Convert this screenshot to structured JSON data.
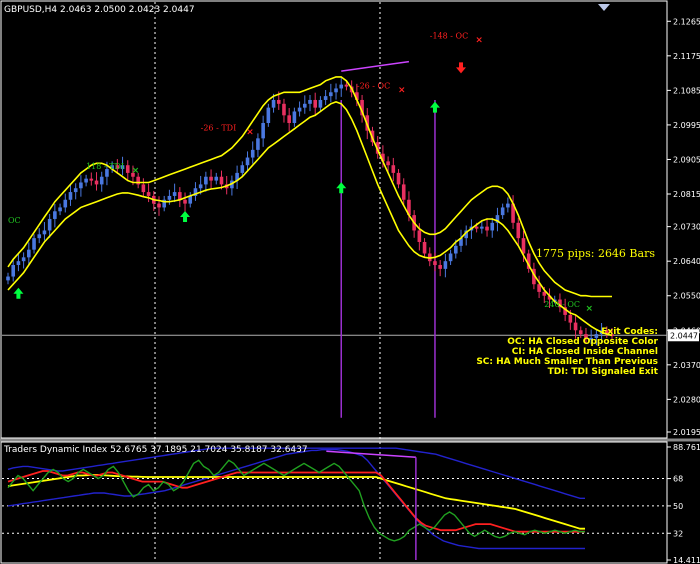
{
  "header": {
    "symbol": "GBPUSD,H4",
    "ohlc": "2.0463 2.0500 2.0423 2.0447"
  },
  "chart_data": [
    {
      "type": "candlestick",
      "name": "main",
      "ylim": [
        2.0195,
        2.131
      ],
      "y_ticks": [
        {
          "value": 2.1265,
          "label": "2.1265"
        },
        {
          "value": 2.1175,
          "label": "2.1175"
        },
        {
          "value": 2.1085,
          "label": "2.1085"
        },
        {
          "value": 2.0995,
          "label": "2.0995"
        },
        {
          "value": 2.0905,
          "label": "2.0905"
        },
        {
          "value": 2.0815,
          "label": "2.0815"
        },
        {
          "value": 2.073,
          "label": "2.0730"
        },
        {
          "value": 2.064,
          "label": "2.0640"
        },
        {
          "value": 2.055,
          "label": "2.0550"
        },
        {
          "value": 2.046,
          "label": "2.0460"
        },
        {
          "value": 2.037,
          "label": "2.0370"
        },
        {
          "value": 2.028,
          "label": "2.0280"
        },
        {
          "value": 2.0195,
          "label": "2.0195"
        }
      ],
      "current_price": {
        "value": 2.0447,
        "label": "2.0447"
      },
      "close_series": [
        2.06,
        2.063,
        2.064,
        2.065,
        2.067,
        2.07,
        2.071,
        2.072,
        2.075,
        2.077,
        2.078,
        2.08,
        2.082,
        2.083,
        2.0845,
        2.0855,
        2.085,
        2.084,
        2.086,
        2.088,
        2.089,
        2.088,
        2.089,
        2.087,
        2.086,
        2.084,
        2.082,
        2.081,
        2.079,
        2.078,
        2.08,
        2.081,
        2.082,
        2.08,
        2.079,
        2.081,
        2.083,
        2.084,
        2.086,
        2.085,
        2.086,
        2.084,
        2.083,
        2.085,
        2.087,
        2.089,
        2.091,
        2.093,
        2.096,
        2.1,
        2.104,
        2.106,
        2.105,
        2.102,
        2.1,
        2.103,
        2.104,
        2.105,
        2.106,
        2.104,
        2.106,
        2.107,
        2.108,
        2.109,
        2.11,
        2.1095,
        2.108,
        2.106,
        2.102,
        2.098,
        2.095,
        2.092,
        2.09,
        2.089,
        2.087,
        2.084,
        2.08,
        2.076,
        2.072,
        2.069,
        2.066,
        2.064,
        2.063,
        2.062,
        2.064,
        2.066,
        2.068,
        2.07,
        2.072,
        2.073,
        2.0725,
        2.073,
        2.072,
        2.074,
        2.076,
        2.078,
        2.079,
        2.074,
        2.07,
        2.066,
        2.062,
        2.058,
        2.056,
        2.055,
        2.054,
        2.054,
        2.052,
        2.05,
        2.048,
        2.046,
        2.045,
        2.044,
        2.044,
        2.045,
        2.046,
        2.045,
        2.0447
      ],
      "upper_band": [
        2.0625,
        2.0645,
        2.066,
        2.0675,
        2.0695,
        2.0715,
        2.0735,
        2.0755,
        2.0775,
        2.0795,
        2.081,
        2.0825,
        2.084,
        2.0855,
        2.087,
        2.088,
        2.089,
        2.0895,
        2.0895,
        2.089,
        2.088,
        2.087,
        2.086,
        2.085,
        2.0845,
        2.0845,
        2.0845,
        2.0845,
        2.085,
        2.0855,
        2.086,
        2.0865,
        2.087,
        2.0875,
        2.088,
        2.0885,
        2.089,
        2.0895,
        2.09,
        2.0905,
        2.091,
        2.0915,
        2.0925,
        2.0935,
        2.095,
        2.0965,
        2.0985,
        2.1005,
        2.1025,
        2.1045,
        2.106,
        2.107,
        2.1075,
        2.108,
        2.108,
        2.108,
        2.108,
        2.1085,
        2.109,
        2.1095,
        2.11,
        2.111,
        2.1115,
        2.112,
        2.112,
        2.111,
        2.109,
        2.106,
        2.103,
        2.0995,
        2.096,
        2.093,
        2.09,
        2.087,
        2.084,
        2.081,
        2.0785,
        2.076,
        2.074,
        2.0725,
        2.0715,
        2.071,
        2.071,
        2.0715,
        2.0725,
        2.074,
        2.0755,
        2.077,
        2.0785,
        2.08,
        2.081,
        2.082,
        2.083,
        2.0835,
        2.0835,
        2.083,
        2.0815,
        2.079,
        2.076,
        2.0725,
        2.069,
        2.066,
        2.0635,
        2.0615,
        2.06,
        2.0585,
        2.0575,
        2.0565,
        2.056,
        2.0555,
        2.055,
        2.055,
        2.0548,
        2.0548,
        2.0548,
        2.0548,
        2.0548
      ],
      "lower_band": [
        2.0565,
        2.058,
        2.0595,
        2.061,
        2.063,
        2.065,
        2.067,
        2.069,
        2.0705,
        2.072,
        2.0735,
        2.075,
        2.076,
        2.077,
        2.078,
        2.0785,
        2.079,
        2.0795,
        2.08,
        2.0805,
        2.081,
        2.0815,
        2.0818,
        2.0818,
        2.0815,
        2.0812,
        2.0808,
        2.0805,
        2.08,
        2.0798,
        2.0795,
        2.0795,
        2.0797,
        2.08,
        2.0805,
        2.081,
        2.0815,
        2.082,
        2.0825,
        2.0828,
        2.083,
        2.0832,
        2.0836,
        2.0842,
        2.085,
        2.086,
        2.0875,
        2.089,
        2.0905,
        2.092,
        2.0935,
        2.0945,
        2.0955,
        2.0965,
        2.0975,
        2.0985,
        2.0995,
        2.1005,
        2.1015,
        2.102,
        2.103,
        2.104,
        2.105,
        2.1055,
        2.105,
        2.1035,
        2.101,
        2.098,
        2.0945,
        2.091,
        2.0875,
        2.084,
        2.081,
        2.078,
        2.075,
        2.072,
        2.07,
        2.068,
        2.0665,
        2.0655,
        2.065,
        2.0648,
        2.065,
        2.0655,
        2.0665,
        2.0675,
        2.069,
        2.07,
        2.0715,
        2.0725,
        2.0735,
        2.0745,
        2.075,
        2.075,
        2.0745,
        2.0735,
        2.072,
        2.07,
        2.068,
        2.0655,
        2.063,
        2.0605,
        2.0585,
        2.0565,
        2.055,
        2.0535,
        2.0525,
        2.0515,
        2.0505,
        2.05,
        2.049,
        2.048,
        2.047,
        2.0462,
        2.0455,
        2.045,
        2.0447
      ],
      "trend_lines": [
        {
          "from_bar": 64,
          "to_bar": 77,
          "y_from": 2.1135,
          "y_to": 2.116,
          "color": "#cc44ff"
        }
      ],
      "vertical_markers": [
        {
          "bar": 64
        },
        {
          "bar": 82
        }
      ],
      "arrows": [
        {
          "bar": 2,
          "price": 2.0555,
          "dir": "up",
          "color": "#00ff40"
        },
        {
          "bar": 34,
          "price": 2.0755,
          "dir": "up",
          "color": "#00ff40"
        },
        {
          "bar": 64,
          "price": 2.083,
          "dir": "up",
          "color": "#00ff40"
        },
        {
          "bar": 82,
          "price": 2.104,
          "dir": "up",
          "color": "#00ff40"
        },
        {
          "bar": 87,
          "price": 2.1145,
          "dir": "down",
          "color": "#ff2020"
        }
      ],
      "annotations": [
        {
          "text": "OC",
          "bar": 0,
          "price": 2.074,
          "color": "#20c020",
          "cross": false
        },
        {
          "text": "118 - TDI",
          "bar": 15,
          "price": 2.088,
          "color": "#20c020",
          "cross": true
        },
        {
          "text": "-26 - TDI",
          "bar": 37,
          "price": 2.098,
          "color": "#ff2020",
          "cross": true
        },
        {
          "text": "-26 - OC",
          "bar": 67,
          "price": 2.109,
          "color": "#ff2020",
          "cross": true
        },
        {
          "text": "-148 - OC",
          "bar": 81,
          "price": 2.122,
          "color": "#ff2020",
          "cross": true
        },
        {
          "text": "246 - OC",
          "bar": 103,
          "price": 2.052,
          "color": "#20c020",
          "cross": true
        }
      ],
      "labels": {
        "pips": "1775 pips: 2646 Bars",
        "exit_codes": [
          "Exit Codes:",
          "OC:  HA Closed Opposite Color",
          "CI:   HA Closed Inside Channel",
          "SC:  HA Much Smaller Than Previous",
          "TDI:  TDI Signaled Exit"
        ]
      },
      "colors": {
        "bull": "#4a78e0",
        "bear": "#e83060",
        "band": "#ffff00",
        "grid": "#ffffff"
      }
    },
    {
      "type": "line",
      "name": "Traders Dynamic Index",
      "title": "Traders Dynamic Index 52.6765 37.1895 21.7024 35.8187 32.6437",
      "ylim": [
        14.4115,
        88.7613
      ],
      "y_ticks": [
        {
          "value": 88.7613,
          "label": "88.7613"
        },
        {
          "value": 68,
          "label": "68"
        },
        {
          "value": 50,
          "label": "50"
        },
        {
          "value": 32,
          "label": "32"
        },
        {
          "value": 14.4115,
          "label": "14.4115"
        }
      ],
      "hlines": [
        68,
        50,
        32
      ],
      "trend_line": {
        "from_bar": 64,
        "to_bar": 82,
        "y_from": 86,
        "y_to": 82,
        "color": "#cc44ff"
      },
      "series": [
        {
          "color": "#2222cc",
          "values": [
            50,
            50.5,
            51,
            51.5,
            52,
            52.5,
            53,
            53.5,
            54,
            54.5,
            55,
            55.5,
            56,
            56.5,
            57,
            57.5,
            58,
            58.5,
            58.5,
            58.5,
            58,
            57.5,
            57,
            56.5,
            56.5,
            57,
            57.5,
            58,
            58.5,
            59,
            59.5,
            60,
            61,
            62,
            63,
            64,
            65,
            66,
            67,
            68,
            69,
            70,
            71,
            72,
            73,
            74,
            75,
            76,
            77,
            78,
            79,
            80,
            81,
            82,
            83,
            84,
            84.5,
            85,
            85.5,
            86,
            86.5,
            86.5,
            87,
            87,
            87,
            87,
            86.5,
            86,
            85,
            84,
            83,
            80,
            76,
            72,
            68,
            64,
            60,
            56,
            52,
            48,
            44,
            40,
            37,
            34,
            31,
            29,
            27,
            26,
            25,
            24,
            23.5,
            23,
            22.5,
            22,
            22,
            22,
            22,
            22,
            22,
            22,
            22,
            22,
            22,
            22,
            22,
            22,
            22,
            22,
            22,
            22,
            22,
            22,
            22,
            22,
            22
          ]
        },
        {
          "color": "#2222cc",
          "values": [
            74,
            75,
            75.5,
            76,
            76,
            75.5,
            75,
            74.5,
            74,
            73.5,
            73,
            73,
            73.5,
            74,
            74.5,
            75,
            75.5,
            76,
            76.5,
            77,
            77.5,
            78,
            78.5,
            79,
            79.5,
            80,
            80.5,
            81,
            81.5,
            82,
            82.5,
            83,
            83.5,
            84,
            84.5,
            85,
            85.5,
            86,
            86.5,
            87,
            87.5,
            88,
            88,
            88,
            88,
            88,
            88,
            88,
            88,
            88,
            88,
            88,
            88,
            88,
            88,
            88,
            88,
            88,
            88,
            88,
            88,
            88,
            88,
            88,
            88,
            88,
            88,
            88,
            88,
            88,
            88,
            88,
            88,
            88,
            88,
            88,
            88,
            88,
            88,
            87.5,
            87,
            86.5,
            86,
            85.5,
            85,
            84.5,
            84,
            83,
            82,
            81,
            80,
            79,
            78,
            77,
            76,
            75,
            74,
            73,
            72,
            71,
            70,
            69,
            68,
            67,
            66,
            65,
            64,
            63,
            62,
            61,
            60,
            59,
            58,
            57,
            56,
            55,
            55
          ]
        },
        {
          "color": "#ffff00",
          "values": [
            63,
            63.5,
            64,
            64.5,
            65,
            65.5,
            66,
            66.5,
            67,
            67.5,
            68,
            68.5,
            69,
            69.5,
            70,
            70,
            70.2,
            70.4,
            70.4,
            70.2,
            70,
            69.8,
            69.6,
            69.5,
            69.4,
            69.3,
            69.2,
            69.1,
            69,
            69,
            69,
            69,
            69,
            69,
            69,
            69,
            69,
            69,
            69,
            69,
            69,
            69,
            69,
            69,
            69,
            69,
            69,
            69,
            69,
            69,
            69,
            69,
            69,
            69,
            69,
            69,
            69,
            69,
            69,
            69,
            69,
            69,
            69,
            69,
            69,
            69,
            69,
            69,
            69,
            69,
            69,
            69,
            69,
            69,
            69,
            68,
            67,
            66,
            65,
            64,
            63,
            62,
            61,
            60,
            59,
            58,
            57,
            56,
            55,
            54.5,
            54,
            53.5,
            53,
            52.5,
            52,
            51.5,
            51,
            50.5,
            50,
            49.5,
            49,
            48.5,
            48,
            47,
            46,
            45,
            44,
            43,
            42,
            41,
            40,
            39,
            38,
            37,
            36,
            35,
            35
          ]
        },
        {
          "color": "#ff2020",
          "values": [
            66,
            67,
            68,
            69,
            70,
            71,
            72,
            73,
            73,
            72,
            71,
            70,
            70,
            71,
            72,
            72,
            71,
            70,
            70,
            71,
            72,
            72,
            71,
            70,
            69,
            68,
            67,
            66,
            66,
            66,
            66,
            66,
            65,
            64,
            63,
            62,
            62,
            63,
            64,
            65,
            66,
            67,
            68,
            69,
            70,
            71,
            72,
            72,
            72,
            72,
            72,
            72,
            72,
            72,
            72,
            72,
            72,
            72,
            72,
            72,
            72,
            72,
            72,
            72,
            72,
            72,
            72,
            72,
            72,
            72,
            72,
            72,
            72,
            72,
            72,
            70,
            66,
            62,
            58,
            54,
            50,
            46,
            42,
            39,
            37,
            36,
            35,
            34,
            34,
            34,
            34,
            35,
            36,
            37,
            38,
            38,
            38,
            38,
            37,
            36,
            35,
            34,
            33,
            33,
            33,
            33,
            33,
            33,
            33,
            33,
            33,
            33,
            33,
            33,
            33,
            33,
            33
          ]
        },
        {
          "color": "#20a020",
          "values": [
            62,
            66,
            70,
            68,
            64,
            60,
            64,
            68,
            72,
            74,
            72,
            68,
            66,
            68,
            72,
            74,
            72,
            70,
            68,
            70,
            74,
            76,
            72,
            66,
            60,
            56,
            58,
            62,
            64,
            60,
            62,
            66,
            64,
            60,
            62,
            66,
            72,
            78,
            80,
            76,
            74,
            70,
            72,
            76,
            80,
            78,
            74,
            70,
            72,
            74,
            76,
            78,
            76,
            74,
            72,
            70,
            72,
            74,
            76,
            78,
            76,
            74,
            72,
            74,
            76,
            78,
            76,
            72,
            68,
            64,
            60,
            50,
            42,
            36,
            32,
            30,
            28,
            27,
            28,
            30,
            34,
            36,
            38,
            36,
            34,
            36,
            40,
            44,
            46,
            44,
            40,
            36,
            32,
            30,
            32,
            34,
            32,
            30,
            29,
            30,
            32,
            33,
            32,
            31,
            33,
            34,
            33,
            32,
            33,
            34,
            33,
            32,
            33,
            34,
            33,
            33
          ]
        }
      ]
    }
  ]
}
